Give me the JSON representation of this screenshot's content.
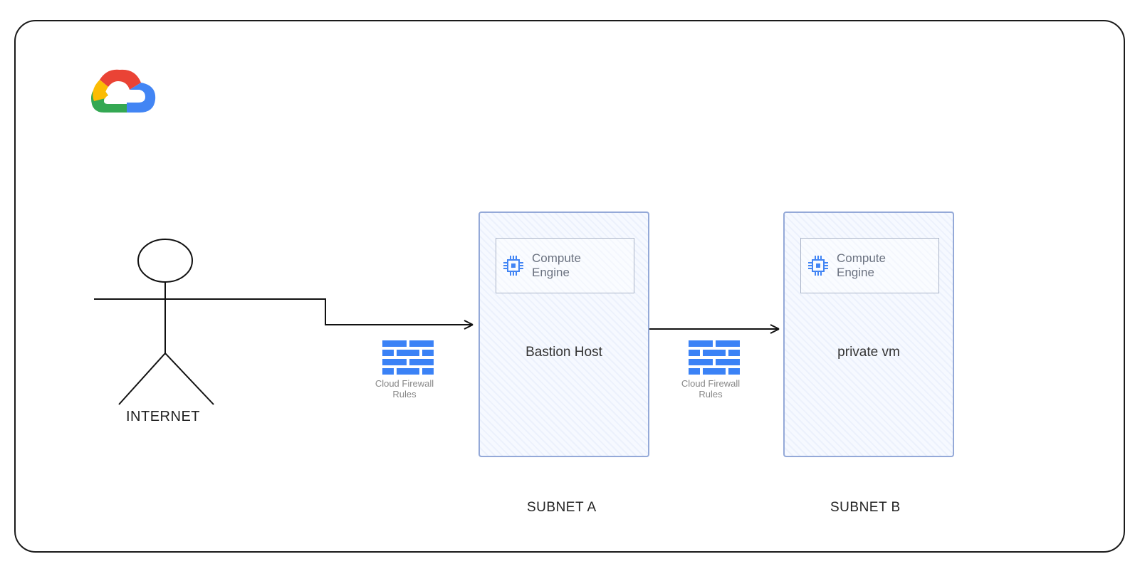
{
  "internet_label": "INTERNET",
  "firewall": {
    "label_line1": "Cloud Firewall",
    "label_line2": "Rules"
  },
  "compute": {
    "line1": "Compute",
    "line2": "Engine"
  },
  "box_a_title": "Bastion Host",
  "box_b_title": "private vm",
  "subnet_a_label": "SUBNET A",
  "subnet_b_label": "SUBNET B"
}
